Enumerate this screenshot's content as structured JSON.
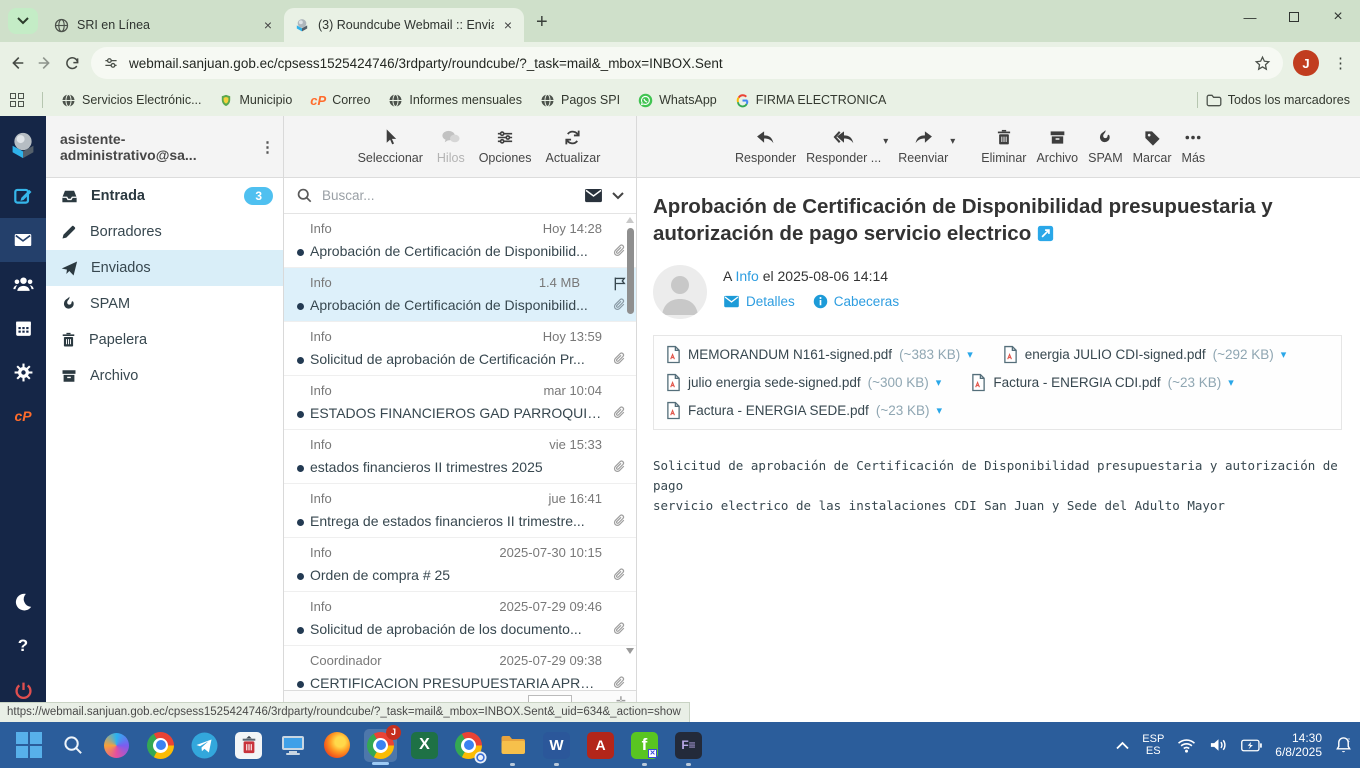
{
  "browser": {
    "tabs": [
      {
        "title": "SRI en Línea"
      },
      {
        "title": "(3) Roundcube Webmail :: Envia"
      }
    ],
    "url": "webmail.sanjuan.gob.ec/cpsess1525424746/3rdparty/roundcube/?_task=mail&_mbox=INBOX.Sent",
    "profile_initial": "J",
    "bookmarks": [
      {
        "label": "Servicios Electrónic..."
      },
      {
        "label": "Municipio"
      },
      {
        "label": "Correo"
      },
      {
        "label": "Informes mensuales"
      },
      {
        "label": "Pagos SPI"
      },
      {
        "label": "WhatsApp"
      },
      {
        "label": "FIRMA ELECTRONICA"
      }
    ],
    "bookmarks_all_label": "Todos los marcadores"
  },
  "webmail": {
    "account": "asistente-administrativo@sa...",
    "folders": [
      {
        "label": "Entrada",
        "badge": "3"
      },
      {
        "label": "Borradores"
      },
      {
        "label": "Enviados"
      },
      {
        "label": "SPAM"
      },
      {
        "label": "Papelera"
      },
      {
        "label": "Archivo"
      }
    ],
    "list_toolbar": {
      "select": "Seleccionar",
      "threads": "Hilos",
      "options": "Opciones",
      "refresh": "Actualizar"
    },
    "search_placeholder": "Buscar...",
    "messages": [
      {
        "sender": "Info",
        "meta": "Hoy 14:28",
        "subject": "Aprobación de Certificación de Disponibilid..."
      },
      {
        "sender": "Info",
        "meta": "1.4 MB",
        "subject": "Aprobación de Certificación de Disponibilid..."
      },
      {
        "sender": "Info",
        "meta": "Hoy 13:59",
        "subject": "Solicitud de aprobación de Certificación Pr..."
      },
      {
        "sender": "Info",
        "meta": "mar 10:04",
        "subject": "ESTADOS FINANCIEROS GAD PARROQUIA..."
      },
      {
        "sender": "Info",
        "meta": "vie 15:33",
        "subject": "estados financieros II trimestres 2025"
      },
      {
        "sender": "Info",
        "meta": "jue 16:41",
        "subject": "Entrega de estados financieros II trimestre..."
      },
      {
        "sender": "Info",
        "meta": "2025-07-30 10:15",
        "subject": "Orden de compra # 25"
      },
      {
        "sender": "Info",
        "meta": "2025-07-29 09:46",
        "subject": "Solicitud de aprobación de los documento..."
      },
      {
        "sender": "Coordinador",
        "meta": "2025-07-29 09:38",
        "subject": "CERTIFICACION PRESUPUESTARIA APROB..."
      }
    ],
    "reader_toolbar": {
      "reply": "Responder",
      "reply_all": "Responder ...",
      "forward": "Reenviar",
      "delete": "Eliminar",
      "archive": "Archivo",
      "spam": "SPAM",
      "mark": "Marcar",
      "more": "Más"
    },
    "subject": "Aprobación de Certificación de Disponibilidad presupuestaria y autorización de pago servicio electrico",
    "meta": {
      "to_prefix": "A",
      "to": "Info",
      "date": "el 2025-08-06 14:14",
      "details": "Detalles",
      "headers": "Cabeceras"
    },
    "attachments": [
      {
        "name": "MEMORANDUM N161-signed.pdf",
        "size": "(~383 KB)"
      },
      {
        "name": "energia JULIO CDI-signed.pdf",
        "size": "(~292 KB)"
      },
      {
        "name": "julio energia sede-signed.pdf",
        "size": "(~300 KB)"
      },
      {
        "name": "Factura - ENERGIA CDI.pdf",
        "size": "(~23 KB)"
      },
      {
        "name": "Factura - ENERGIA SEDE.pdf",
        "size": "(~23 KB)"
      }
    ],
    "body_lines": [
      "Solicitud de aprobación de Certificación de Disponibilidad presupuestaria y autorización de pago",
      "servicio electrico de las instalaciones CDI San Juan y Sede del Adulto Mayor"
    ]
  },
  "statusbar": {
    "url": "https://webmail.sanjuan.gob.ec/cpsess1525424746/3rdparty/roundcube/?_task=mail&_mbox=INBOX.Sent&_uid=634&_action=show"
  },
  "taskbar": {
    "lang_top": "ESP",
    "lang_bottom": "ES",
    "time": "14:30",
    "date": "6/8/2025"
  }
}
